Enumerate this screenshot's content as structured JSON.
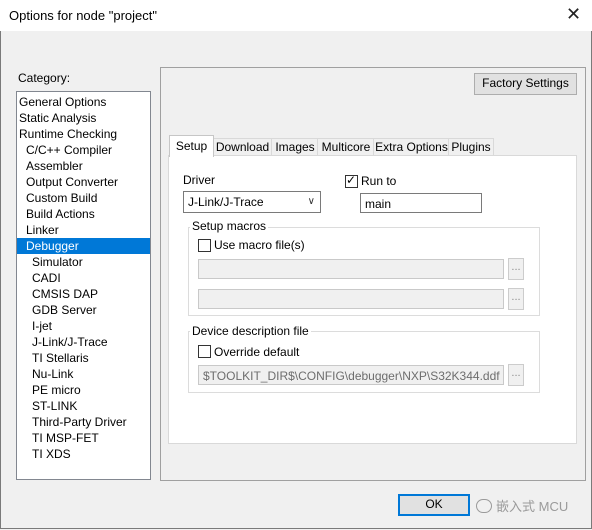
{
  "window": {
    "title": "Options for node \"project\"",
    "close_glyph": "✕"
  },
  "category": {
    "label": "Category:",
    "items": [
      {
        "label": "General Options",
        "indent": 0
      },
      {
        "label": "Static Analysis",
        "indent": 0
      },
      {
        "label": "Runtime Checking",
        "indent": 0
      },
      {
        "label": "C/C++ Compiler",
        "indent": 1
      },
      {
        "label": "Assembler",
        "indent": 1
      },
      {
        "label": "Output Converter",
        "indent": 1
      },
      {
        "label": "Custom Build",
        "indent": 1
      },
      {
        "label": "Build Actions",
        "indent": 1
      },
      {
        "label": "Linker",
        "indent": 1
      },
      {
        "label": "Debugger",
        "indent": 1,
        "selected": true
      },
      {
        "label": "Simulator",
        "indent": 2
      },
      {
        "label": "CADI",
        "indent": 2
      },
      {
        "label": "CMSIS DAP",
        "indent": 2
      },
      {
        "label": "GDB Server",
        "indent": 2
      },
      {
        "label": "I-jet",
        "indent": 2
      },
      {
        "label": "J-Link/J-Trace",
        "indent": 2
      },
      {
        "label": "TI Stellaris",
        "indent": 2
      },
      {
        "label": "Nu-Link",
        "indent": 2
      },
      {
        "label": "PE micro",
        "indent": 2
      },
      {
        "label": "ST-LINK",
        "indent": 2
      },
      {
        "label": "Third-Party Driver",
        "indent": 2
      },
      {
        "label": "TI MSP-FET",
        "indent": 2
      },
      {
        "label": "TI XDS",
        "indent": 2
      }
    ]
  },
  "factory_settings_label": "Factory Settings",
  "tabs": [
    "Setup",
    "Download",
    "Images",
    "Multicore",
    "Extra Options",
    "Plugins"
  ],
  "setup": {
    "driver_label": "Driver",
    "driver_value": "J-Link/J-Trace",
    "run_to_label": "Run to",
    "run_to_checked": true,
    "run_to_value": "main",
    "setup_macros_label": "Setup macros",
    "use_macro_label": "Use macro file(s)",
    "use_macro_checked": false,
    "macro_file_1": "",
    "macro_file_2": "",
    "browse_label": "...",
    "device_desc_label": "Device description file",
    "override_default_label": "Override default",
    "override_default_checked": false,
    "device_desc_path": "$TOOLKIT_DIR$\\CONFIG\\debugger\\NXP\\S32K344.ddf"
  },
  "footer": {
    "ok_label": "OK",
    "watermark_text": "嵌入式 MCU"
  },
  "colors": {
    "selection": "#0078d7",
    "dialog_bg": "#f0f0f0"
  }
}
